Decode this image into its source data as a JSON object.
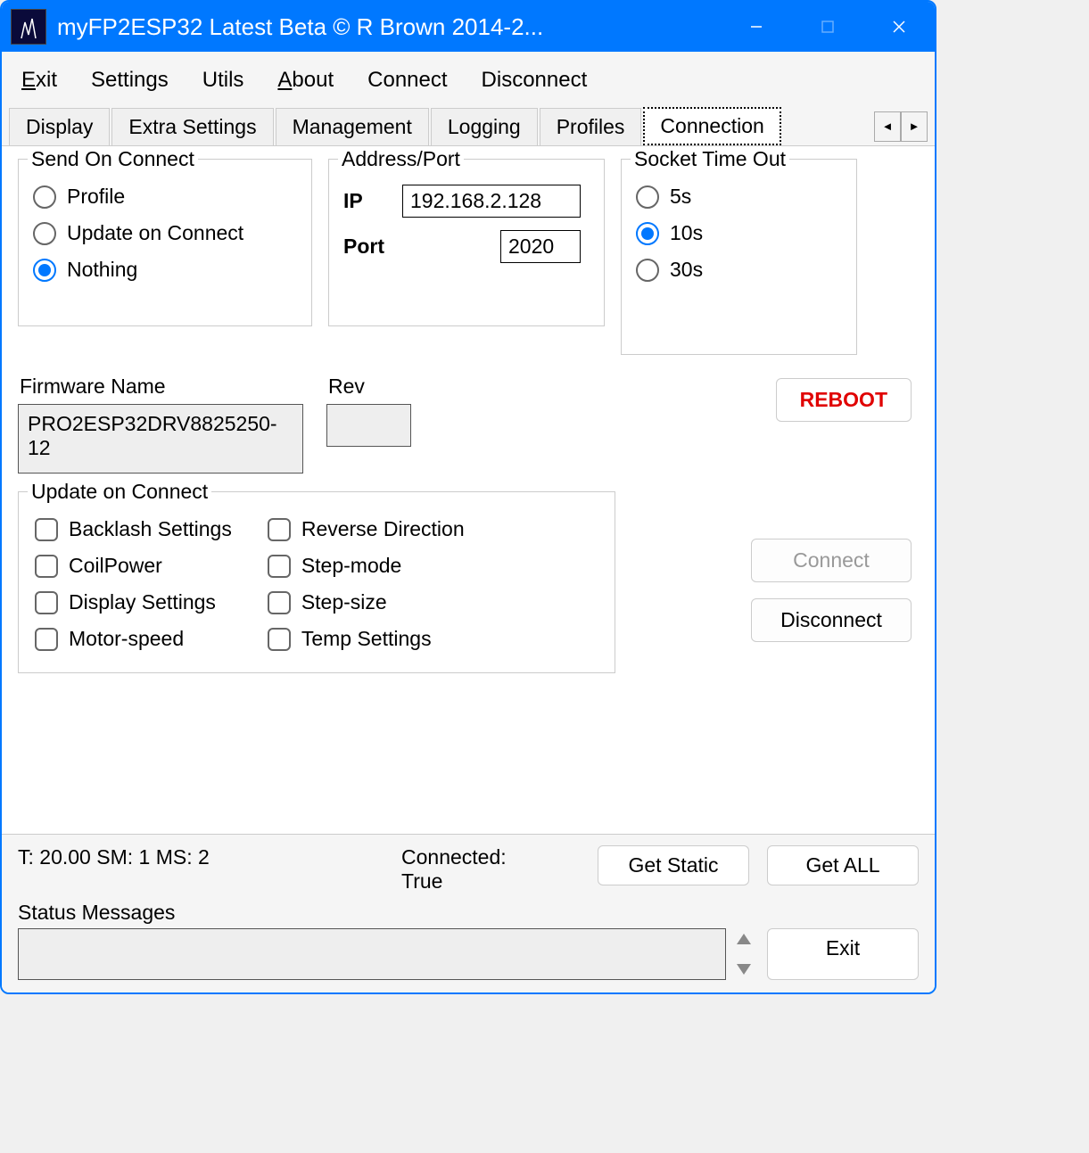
{
  "titlebar": {
    "title": "myFP2ESP32 Latest Beta © R Brown 2014-2..."
  },
  "menu": {
    "exit": "Exit",
    "settings": "Settings",
    "utils": "Utils",
    "about": "About",
    "connect": "Connect",
    "disconnect": "Disconnect"
  },
  "tabs": {
    "display": "Display",
    "extra": "Extra Settings",
    "management": "Management",
    "logging": "Logging",
    "profiles": "Profiles",
    "connection": "Connection"
  },
  "send_on_connect": {
    "legend": "Send On Connect",
    "profile": "Profile",
    "update": "Update on Connect",
    "nothing": "Nothing"
  },
  "address_port": {
    "legend": "Address/Port",
    "ip_label": "IP",
    "ip_value": "192.168.2.128",
    "port_label": "Port",
    "port_value": "2020"
  },
  "socket_timeout": {
    "legend": "Socket Time Out",
    "s5": "5s",
    "s10": "10s",
    "s30": "30s"
  },
  "firmware": {
    "name_label": "Firmware Name",
    "name_value": "PRO2ESP32DRV8825250-12",
    "rev_label": "Rev",
    "rev_value": ""
  },
  "reboot": "REBOOT",
  "update_on_connect": {
    "legend": "Update on Connect",
    "backlash": "Backlash Settings",
    "coilpower": "CoilPower",
    "display": "Display Settings",
    "motorspeed": "Motor-speed",
    "reverse": "Reverse Direction",
    "stepmode": "Step-mode",
    "stepsize": "Step-size",
    "temp": "Temp Settings"
  },
  "buttons": {
    "connect": "Connect",
    "disconnect": "Disconnect"
  },
  "footer": {
    "stats": "T:  20.00 SM:    1     MS: 2",
    "connected_label": "Connected:",
    "connected_value": "True",
    "get_static": "Get Static",
    "get_all": "Get ALL",
    "status_label": "Status Messages",
    "exit": "Exit"
  }
}
